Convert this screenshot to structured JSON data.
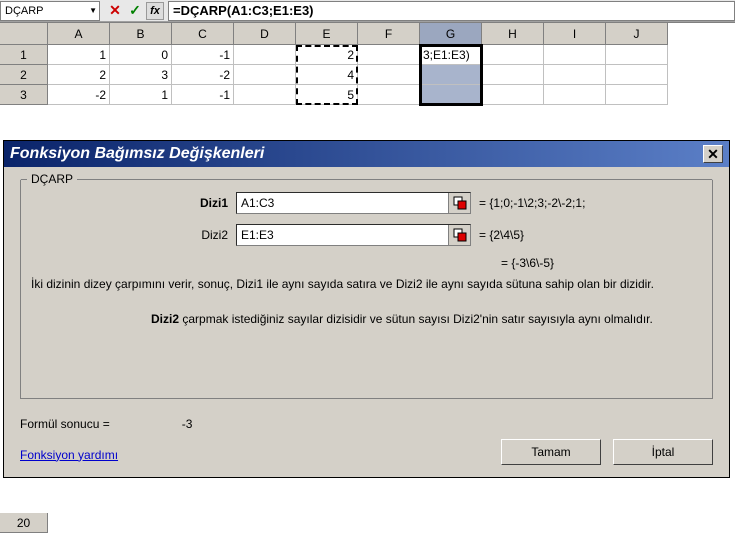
{
  "formula_bar": {
    "name_box": "DÇARP",
    "cancel": "✕",
    "accept": "✓",
    "fx": "fx",
    "formula": "=DÇARP(A1:C3;E1:E3)"
  },
  "columns": [
    "A",
    "B",
    "C",
    "D",
    "E",
    "F",
    "G",
    "H",
    "I",
    "J"
  ],
  "rows": [
    "1",
    "2",
    "3"
  ],
  "cells": {
    "A1": "1",
    "B1": "0",
    "C1": "-1",
    "E1": "2",
    "G1": "3;E1:E3)",
    "A2": "2",
    "B2": "3",
    "C2": "-2",
    "E2": "4",
    "A3": "-2",
    "B3": "1",
    "C3": "-1",
    "E3": "5"
  },
  "dialog": {
    "title": "Fonksiyon Bağımsız Değişkenleri",
    "legend": "DÇARP",
    "args": [
      {
        "label": "Dizi1",
        "value": "A1:C3",
        "result": "= {1;0;-1\\2;3;-2\\-2;1;",
        "bold": true
      },
      {
        "label": "Dizi2",
        "value": "E1:E3",
        "result": "= {2\\4\\5}",
        "bold": false
      }
    ],
    "overall_result": "= {-3\\6\\-5}",
    "description": "İki dizinin dizey çarpımını verir, sonuç, Dizi1 ile aynı sayıda satıra ve Dizi2 ile aynı sayıda sütuna sahip olan bir dizidir.",
    "param_name": "Dizi2",
    "param_desc": "çarpmak istediğiniz sayılar dizisidir ve sütun sayısı Dizi2'nin satır sayısıyla aynı olmalıdır.",
    "formula_result_label": "Formül sonucu =",
    "formula_result_value": "-3",
    "help_link": "Fonksiyon yardımı",
    "ok": "Tamam",
    "cancel": "İptal"
  },
  "row20": "20"
}
